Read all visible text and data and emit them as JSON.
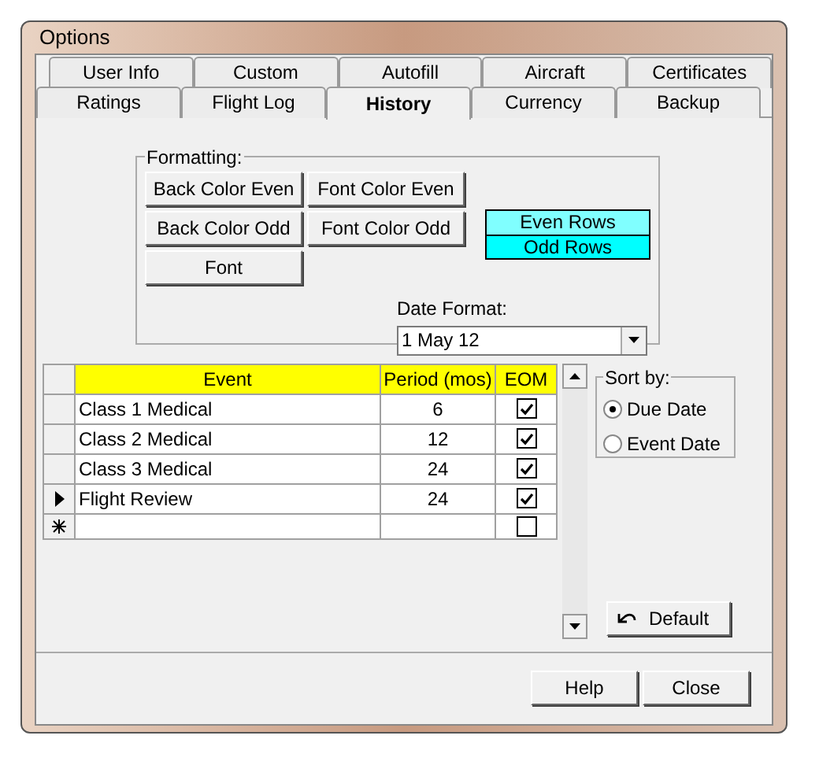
{
  "window": {
    "title": "Options"
  },
  "tab_rows": [
    [
      {
        "label": "User Info",
        "selected": false
      },
      {
        "label": "Custom",
        "selected": false
      },
      {
        "label": "Autofill",
        "selected": false
      },
      {
        "label": "Aircraft",
        "selected": false
      },
      {
        "label": "Certificates",
        "selected": false
      }
    ],
    [
      {
        "label": "Ratings",
        "selected": false
      },
      {
        "label": "Flight Log",
        "selected": false
      },
      {
        "label": "History",
        "selected": true
      },
      {
        "label": "Currency",
        "selected": false
      },
      {
        "label": "Backup",
        "selected": false
      }
    ]
  ],
  "formatting": {
    "title": "Formatting:",
    "buttons": [
      "Back Color Even",
      "Font Color Even",
      "Back Color Odd",
      "Font Color Odd",
      "Font"
    ],
    "samples": [
      {
        "label": "Even Rows",
        "color": "#80ffff"
      },
      {
        "label": "Odd Rows",
        "color": "#00ffff"
      }
    ],
    "date_format": {
      "label": "Date Format:",
      "value": "1 May 12"
    }
  },
  "grid": {
    "columns": [
      "Event",
      "Period (mos)",
      "EOM"
    ],
    "rows": [
      {
        "kind": "entry",
        "current": false,
        "event": "Class 1 Medical",
        "period": "6",
        "eom": true
      },
      {
        "kind": "entry",
        "current": false,
        "event": "Class 2 Medical",
        "period": "12",
        "eom": true
      },
      {
        "kind": "entry",
        "current": false,
        "event": "Class 3 Medical",
        "period": "24",
        "eom": true
      },
      {
        "kind": "entry",
        "current": true,
        "event": "Flight Review",
        "period": "24",
        "eom": true
      },
      {
        "kind": "new",
        "eom": false
      }
    ]
  },
  "sort": {
    "title": "Sort by:",
    "options": [
      {
        "label": "Due Date",
        "selected": true
      },
      {
        "label": "Event Date",
        "selected": false
      }
    ]
  },
  "default_button": "Default",
  "footer_buttons": [
    "Help",
    "Close"
  ]
}
